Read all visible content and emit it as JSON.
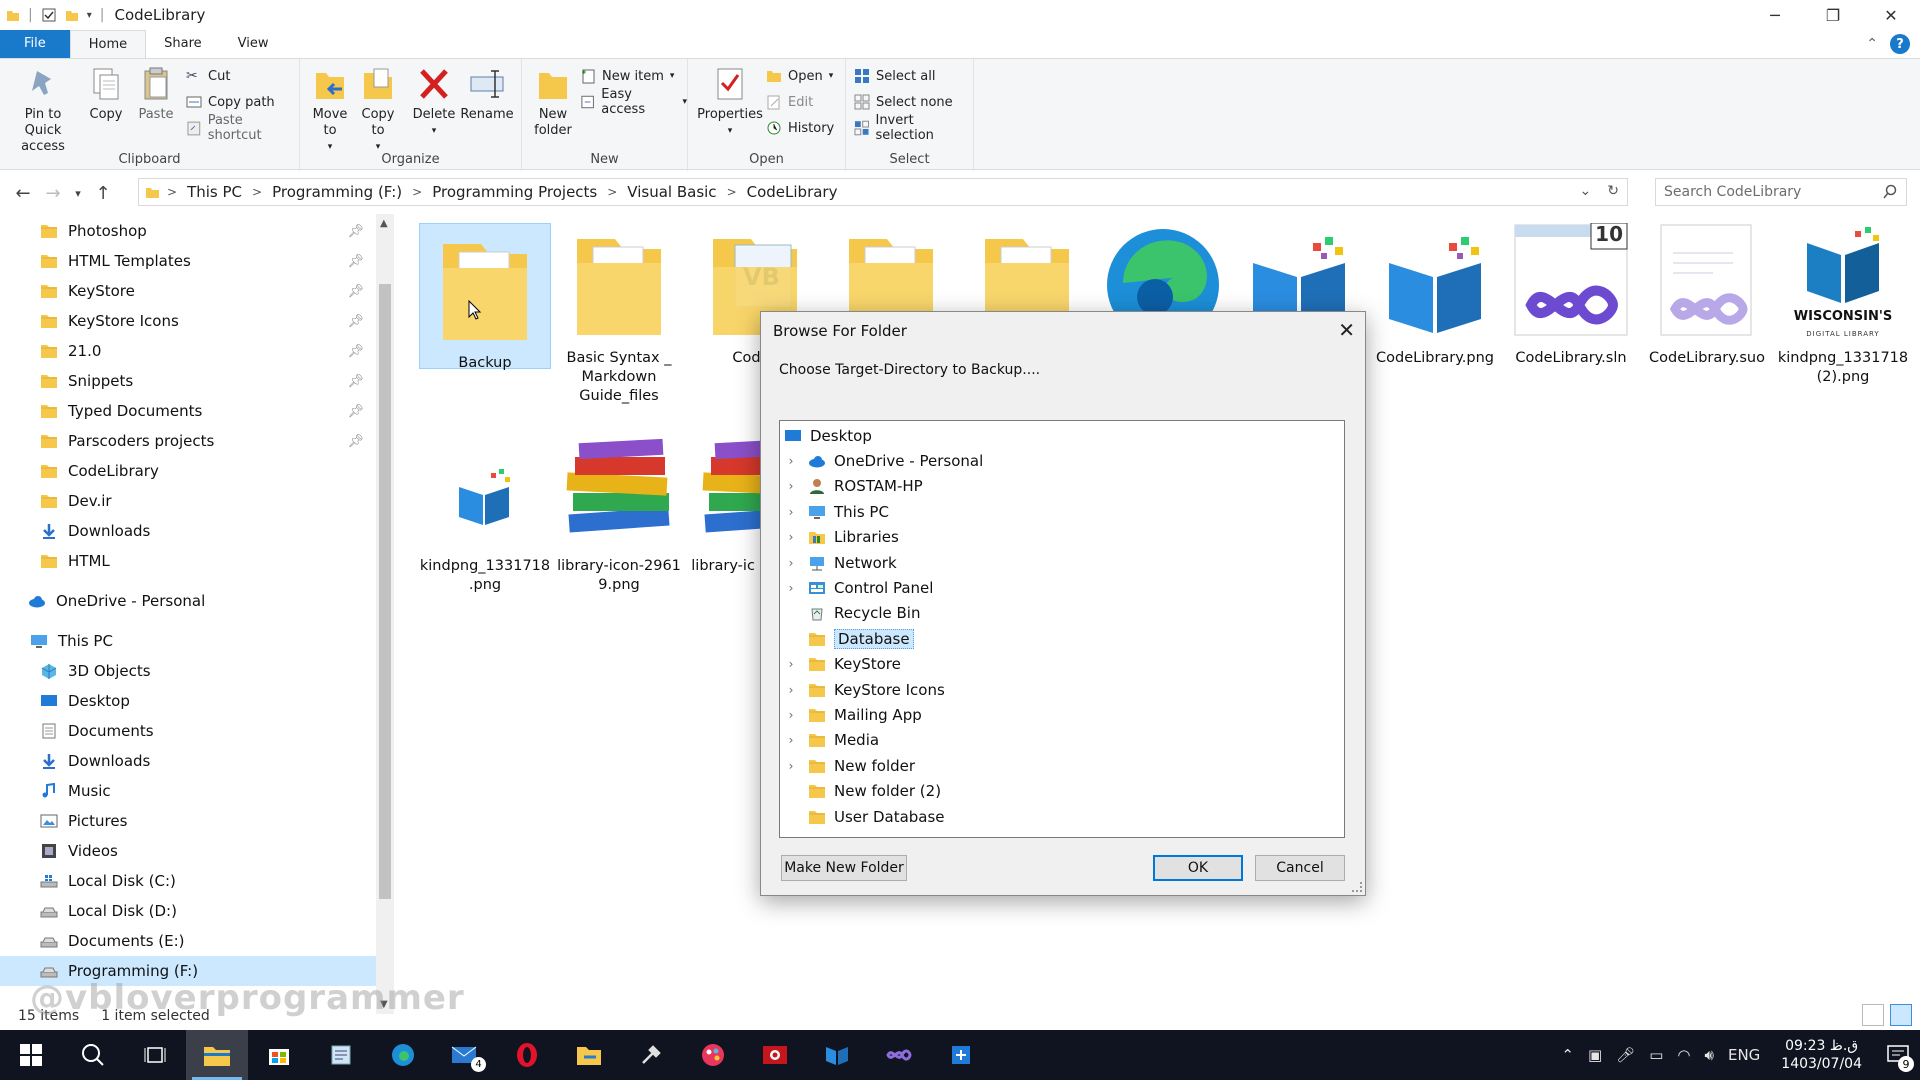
{
  "window": {
    "title": "CodeLibrary",
    "controls": [
      "minimize",
      "maximize",
      "close"
    ]
  },
  "ribbon_tabs": {
    "file": "File",
    "home": "Home",
    "share": "Share",
    "view": "View"
  },
  "ribbon": {
    "clipboard": {
      "label": "Clipboard",
      "pin": "Pin to Quick access",
      "copy": "Copy",
      "paste": "Paste",
      "cut": "Cut",
      "copy_path": "Copy path",
      "paste_shortcut": "Paste shortcut"
    },
    "organize": {
      "label": "Organize",
      "move_to": "Move to",
      "copy_to": "Copy to",
      "delete": "Delete",
      "rename": "Rename"
    },
    "new": {
      "label": "New",
      "new_folder": "New folder",
      "new_item": "New item",
      "easy_access": "Easy access"
    },
    "open": {
      "label": "Open",
      "properties": "Properties",
      "open": "Open",
      "edit": "Edit",
      "history": "History"
    },
    "select": {
      "label": "Select",
      "select_all": "Select all",
      "select_none": "Select none",
      "invert": "Invert selection"
    }
  },
  "address": {
    "crumbs": [
      "This PC",
      "Programming (F:)",
      "Programming Projects",
      "Visual Basic",
      "CodeLibrary"
    ],
    "search_placeholder": "Search CodeLibrary"
  },
  "nav_pane": {
    "quick_access": [
      {
        "label": "Photoshop",
        "pinned": true
      },
      {
        "label": "HTML Templates",
        "pinned": true
      },
      {
        "label": "KeyStore",
        "pinned": true
      },
      {
        "label": "KeyStore Icons",
        "pinned": true
      },
      {
        "label": "21.0",
        "pinned": true
      },
      {
        "label": "Snippets",
        "pinned": true
      },
      {
        "label": "Typed Documents",
        "pinned": true
      },
      {
        "label": "Parscoders projects",
        "pinned": true
      },
      {
        "label": "CodeLibrary",
        "pinned": false
      },
      {
        "label": "Dev.ir",
        "pinned": false
      },
      {
        "label": "Downloads",
        "pinned": false
      },
      {
        "label": "HTML",
        "pinned": false
      }
    ],
    "onedrive": "OneDrive - Personal",
    "this_pc": "This PC",
    "this_pc_items": [
      "3D Objects",
      "Desktop",
      "Documents",
      "Downloads",
      "Music",
      "Pictures",
      "Videos",
      "Local Disk (C:)",
      "Local Disk (D:)",
      "Documents (E:)",
      "Programming (F:)"
    ]
  },
  "files": [
    {
      "name": "Backup",
      "type": "folder",
      "selected": true
    },
    {
      "name": "Basic Syntax _ Markdown Guide_files",
      "type": "folder"
    },
    {
      "name": "CodeL",
      "type": "folder-vb"
    },
    {
      "name": "",
      "type": "folder"
    },
    {
      "name": "",
      "type": "folder"
    },
    {
      "name": "",
      "type": "edge"
    },
    {
      "name": "",
      "type": "book"
    },
    {
      "name": "CodeLibrary.png",
      "type": "book"
    },
    {
      "name": "CodeLibrary.sln",
      "type": "vs-sln"
    },
    {
      "name": "CodeLibrary.suo",
      "type": "vs-suo"
    },
    {
      "name": "kindpng_1331718 (2).png",
      "type": "wisconsin"
    },
    {
      "name": "kindpng_1331718 .png",
      "type": "book-small"
    },
    {
      "name": "library-icon-2961 9.png",
      "type": "books"
    },
    {
      "name": "library-ic 9-Windo",
      "type": "books"
    }
  ],
  "sln_badge": "10",
  "wisconsin_text": "WISCONSIN'S",
  "wisconsin_sub": "DIGITAL LIBRARY",
  "status": {
    "count": "15 items",
    "selection": "1 item selected"
  },
  "watermark": "@vbloverprogrammer",
  "dialog": {
    "title": "Browse For Folder",
    "description": "Choose Target-Directory to Backup....",
    "tree": [
      {
        "label": "Desktop",
        "expander": false,
        "icon": "desktop"
      },
      {
        "label": "OneDrive - Personal",
        "expander": true,
        "icon": "cloud"
      },
      {
        "label": "ROSTAM-HP",
        "expander": true,
        "icon": "user"
      },
      {
        "label": "This PC",
        "expander": true,
        "icon": "pc"
      },
      {
        "label": "Libraries",
        "expander": true,
        "icon": "library"
      },
      {
        "label": "Network",
        "expander": true,
        "icon": "network"
      },
      {
        "label": "Control Panel",
        "expander": true,
        "icon": "control"
      },
      {
        "label": "Recycle Bin",
        "expander": false,
        "icon": "recycle"
      },
      {
        "label": "Database",
        "expander": false,
        "icon": "folder",
        "selected": true
      },
      {
        "label": "KeyStore",
        "expander": true,
        "icon": "folder"
      },
      {
        "label": "KeyStore Icons",
        "expander": true,
        "icon": "folder"
      },
      {
        "label": "Mailing App",
        "expander": true,
        "icon": "folder"
      },
      {
        "label": "Media",
        "expander": true,
        "icon": "folder"
      },
      {
        "label": "New folder",
        "expander": true,
        "icon": "folder"
      },
      {
        "label": "New folder (2)",
        "expander": false,
        "icon": "folder"
      },
      {
        "label": "User Database",
        "expander": false,
        "icon": "folder"
      }
    ],
    "make_new_folder": "Make New Folder",
    "ok": "OK",
    "cancel": "Cancel"
  },
  "taskbar": {
    "mail_badge": "4",
    "lang": "ENG",
    "time": "09:23 ق.ظ",
    "date": "1403/07/04",
    "notif_count": "9"
  },
  "colors": {
    "accent": "#1979ca",
    "selection": "#cce8ff",
    "folder": "#f5c84c",
    "taskbar": "#101420"
  }
}
